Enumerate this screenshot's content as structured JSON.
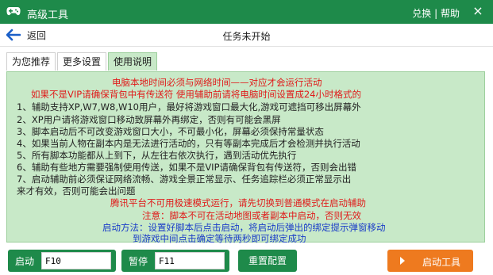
{
  "window": {
    "title": "高级工具",
    "link_switch": "兑换",
    "separator": "|",
    "link_help": "帮助",
    "close_glyph": "×"
  },
  "toolbar": {
    "back_label": "返回",
    "status": "任务未开始"
  },
  "tabs": [
    {
      "label": "为您推荐",
      "active": false
    },
    {
      "label": "更多设置",
      "active": false
    },
    {
      "label": "使用说明",
      "active": true
    }
  ],
  "instructions": {
    "heading1": "电脑本地时间必须与网络时间——对应才会运行活动",
    "heading2": "如果不是VIP请确保背包中有传送符 使用辅助前请将电脑时间设置成24小时格式的",
    "items": [
      "1、辅助支持XP,W7,W8,W10用户，最好将游戏窗口最大化,游戏可遮挡可移出屏幕外",
      "2、XP用户请将游戏窗口移动致屏幕外再绑定，否则有可能会黑屏",
      "3、脚本启动后不可改变游戏窗口大小，不可最小化，屏幕必须保持常量状态",
      "4、如果当前人物在副本内是无法进行活动的，只有等副本完成后才会检测并执行活动",
      "5、所有脚本功能都从上到下，从左往右依次执行，遇到活动优先执行",
      "6、辅助有些地方需要强制使用传送，如果不是VIP请确保背包有传送符，否则会出错",
      "7、启动辅助前必须保证网络流畅、游戏全景正常显示、任务追踪栏必须正常显示出",
      "来才有效，否则可能会出问题"
    ],
    "warn1": "腾讯平台不可用极速模式运行，请先切换到普通模式在启动辅助",
    "warn2": "注意：脚本不可在活动地图或者副本中启动，否则无效",
    "method1": "启动方法：设置好脚本后点击启动，将启动后弹出的绑定提示弹窗移动",
    "method2": "到游戏中间点击确定等待两秒即可绑定成功"
  },
  "bottom": {
    "start_label": "启动",
    "start_hotkey": "F10",
    "pause_label": "暂停",
    "pause_hotkey": "F11",
    "reset_label": "重置配置",
    "launch_label": "启动工具"
  },
  "colors": {
    "brand_green": "#1e8a4a",
    "panel_green": "#c8e9c8",
    "warning_red": "#e01a1a",
    "info_blue": "#1a3cc8",
    "launch_orange": "#ee7a1f"
  }
}
